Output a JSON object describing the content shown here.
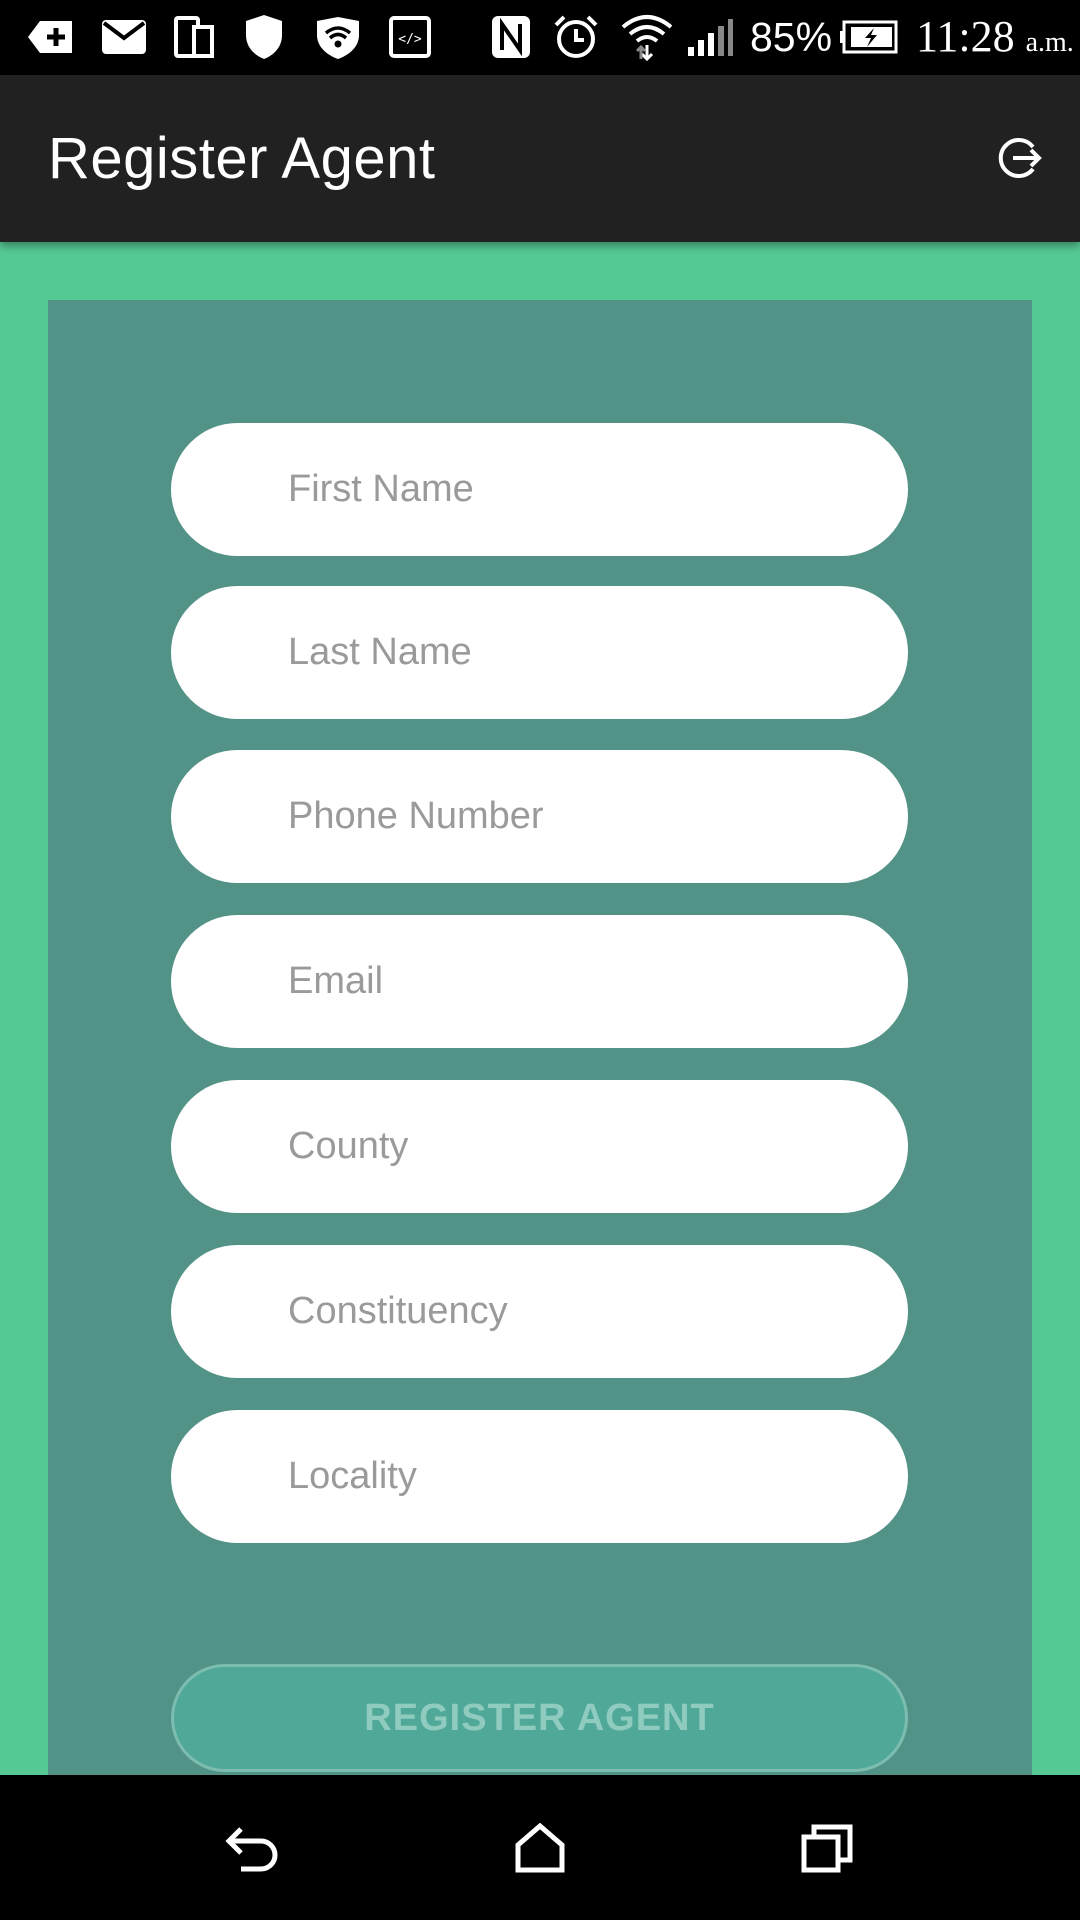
{
  "status_bar": {
    "battery_percent": "85%",
    "time": "11:28",
    "time_suffix": "a.m.",
    "icons": [
      "add-notification-icon",
      "mail-icon",
      "devices-icon",
      "shield-icon",
      "wifi-lock-icon",
      "code-icon",
      "nfc-icon",
      "alarm-icon",
      "wifi-icon",
      "signal-icon",
      "battery-charging-icon"
    ]
  },
  "app_bar": {
    "title": "Register Agent",
    "action_icon": "logout-icon"
  },
  "form": {
    "fields": [
      {
        "placeholder": "First Name",
        "value": ""
      },
      {
        "placeholder": "Last Name",
        "value": ""
      },
      {
        "placeholder": "Phone Number",
        "value": ""
      },
      {
        "placeholder": "Email",
        "value": ""
      },
      {
        "placeholder": "County",
        "value": ""
      },
      {
        "placeholder": "Constituency",
        "value": ""
      },
      {
        "placeholder": "Locality",
        "value": ""
      }
    ],
    "submit_label": "REGISTER AGENT"
  },
  "nav_bar": {
    "icons": [
      "back-icon",
      "home-icon",
      "recents-icon"
    ]
  },
  "colors": {
    "background": "#55c994",
    "card": "#539387",
    "app_bar": "#212121",
    "button": "#50a898",
    "button_text": "#8fcbbe",
    "placeholder": "#9a9a9a"
  }
}
